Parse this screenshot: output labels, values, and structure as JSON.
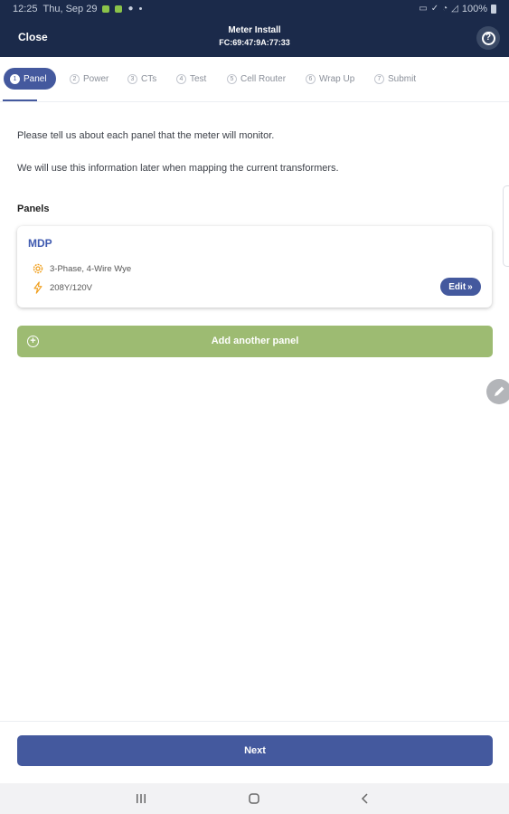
{
  "status_bar": {
    "time": "12:25",
    "date": "Thu, Sep 29",
    "battery": "100%"
  },
  "header": {
    "close_label": "Close",
    "title": "Meter Install",
    "subtitle": "FC:69:47:9A:77:33",
    "help_glyph": "?"
  },
  "steps": [
    {
      "num": "1",
      "label": "Panel",
      "active": true
    },
    {
      "num": "2",
      "label": "Power",
      "active": false
    },
    {
      "num": "3",
      "label": "CTs",
      "active": false
    },
    {
      "num": "4",
      "label": "Test",
      "active": false
    },
    {
      "num": "5",
      "label": "Cell Router",
      "active": false
    },
    {
      "num": "6",
      "label": "Wrap Up",
      "active": false
    },
    {
      "num": "7",
      "label": "Submit",
      "active": false
    }
  ],
  "intro": {
    "line1": "Please tell us about each panel that the meter will monitor.",
    "line2": "We will use this information later when mapping the current transformers."
  },
  "panels_heading": "Panels",
  "panel": {
    "name": "MDP",
    "service": "3-Phase, 4-Wire Wye",
    "voltage": "208Y/120V",
    "edit_label": "Edit",
    "edit_glyph": "»"
  },
  "add_panel_label": "Add another panel",
  "next_label": "Next",
  "colors": {
    "navy": "#1b2a4a",
    "accent": "#44599e",
    "link": "#3f5ab0",
    "add_green": "#9dbb72",
    "icon_orange": "#f0a020"
  },
  "icons": [
    "gear-icon",
    "bolt-icon",
    "help-icon",
    "plus-circle-icon",
    "pencil-icon",
    "recents-icon",
    "home-icon",
    "back-icon"
  ]
}
